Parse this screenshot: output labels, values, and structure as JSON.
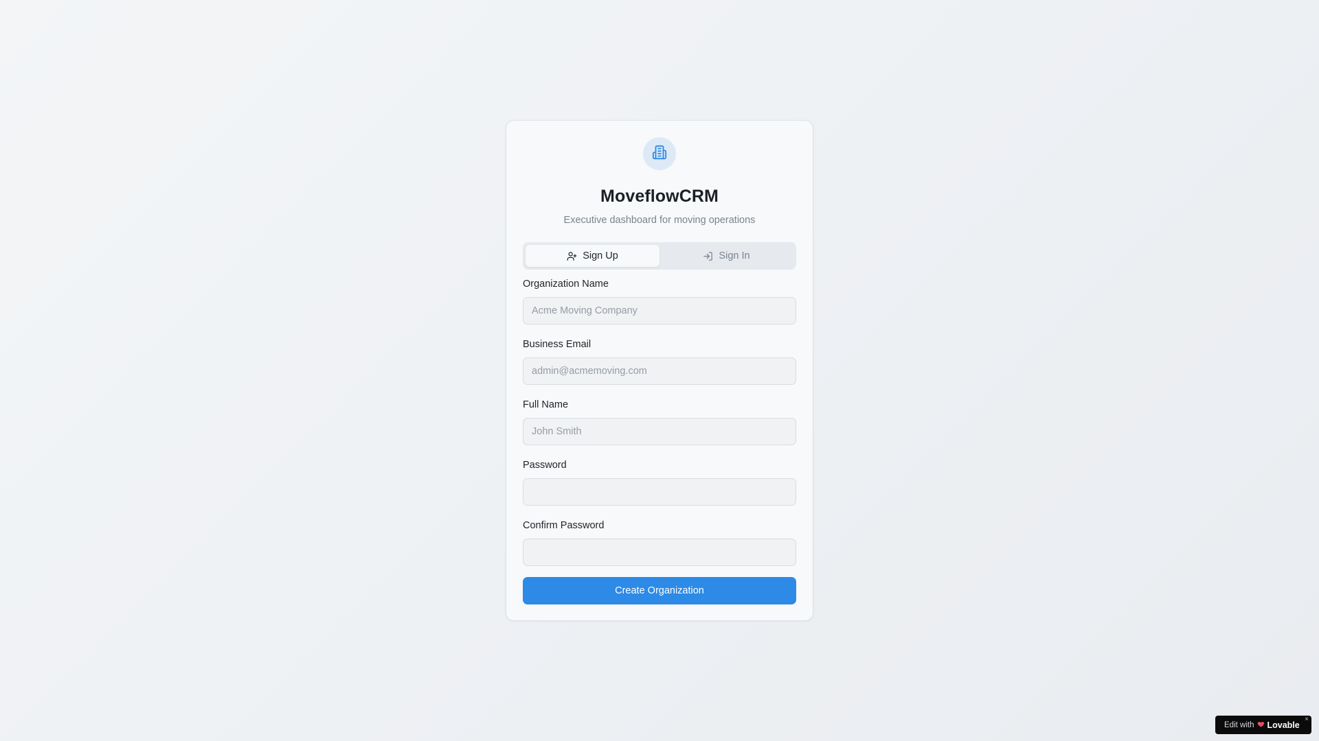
{
  "app": {
    "title": "MoveflowCRM",
    "subtitle": "Executive dashboard for moving operations",
    "logo_icon": "building-icon",
    "accent_color": "#2d8ae6"
  },
  "tabs": [
    {
      "label": "Sign Up",
      "icon": "user-plus-icon",
      "active": true
    },
    {
      "label": "Sign In",
      "icon": "log-in-icon",
      "active": false
    }
  ],
  "form": {
    "fields": [
      {
        "label": "Organization Name",
        "placeholder": "Acme Moving Company",
        "value": "",
        "type": "text"
      },
      {
        "label": "Business Email",
        "placeholder": "admin@acmemoving.com",
        "value": "",
        "type": "email"
      },
      {
        "label": "Full Name",
        "placeholder": "John Smith",
        "value": "",
        "type": "text"
      },
      {
        "label": "Password",
        "placeholder": "",
        "value": "",
        "type": "password"
      },
      {
        "label": "Confirm Password",
        "placeholder": "",
        "value": "",
        "type": "password"
      }
    ],
    "submit_label": "Create Organization"
  },
  "badge": {
    "prefix": "Edit with",
    "brand": "Lovable",
    "close": "×"
  }
}
